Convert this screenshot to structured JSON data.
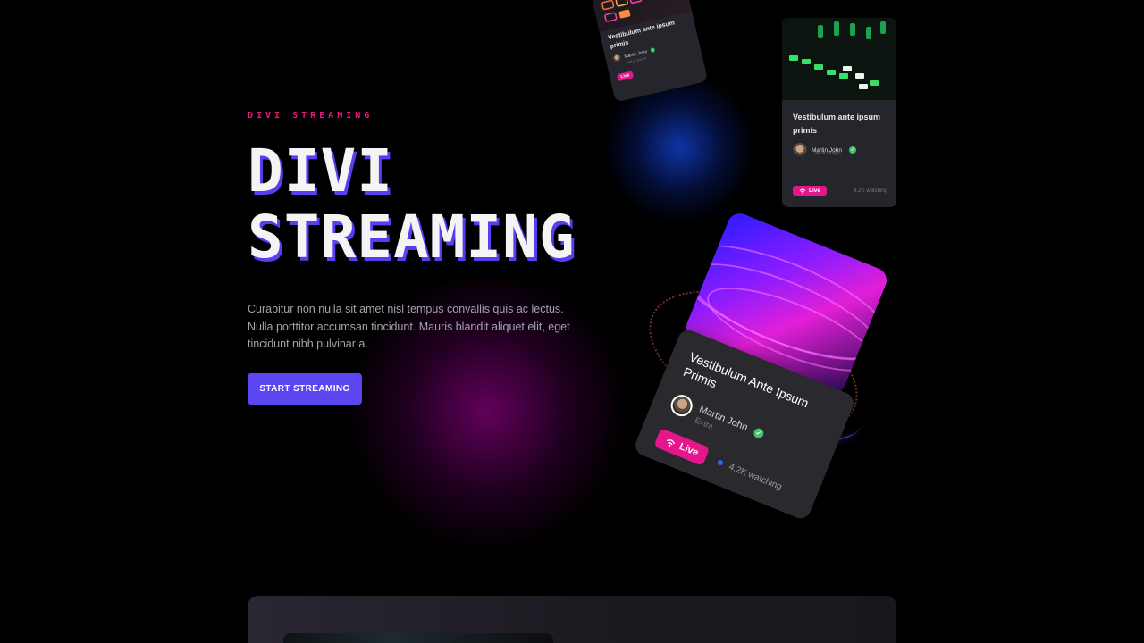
{
  "hero": {
    "eyebrow": "DIVI STREAMING",
    "title_line1": "DIVI",
    "title_line2": "STREAMING",
    "description": "Curabitur non nulla sit amet nisl tempus convallis quis ac lectus. Nulla porttitor accumsan tincidunt. Mauris blandit aliquet elit, eget tincidunt nibh pulvinar a.",
    "cta_label": "START STREAMING"
  },
  "cards": {
    "small": {
      "title": "Vestibulum ante ipsum primis",
      "author": "Martin John",
      "subtitle": "Call of Duty®",
      "live": "Live"
    },
    "side": {
      "title": "Vestibulum ante ipsum primis",
      "author": "Martin John",
      "subtitle": "Call of Duty®",
      "live": "Live",
      "watching": "4.2K watching"
    },
    "featured": {
      "title": "Vestibulum Ante Ipsum Primis",
      "author": "Martin John",
      "subtitle": "Extra",
      "live": "Live",
      "watching": "4.2K watching"
    }
  },
  "icons": {
    "verified": "check-badge-icon",
    "live": "broadcast-icon"
  },
  "colors": {
    "accent_pink": "#e5168c",
    "accent_purple": "#5b46f2",
    "verified_green": "#44c36a"
  }
}
